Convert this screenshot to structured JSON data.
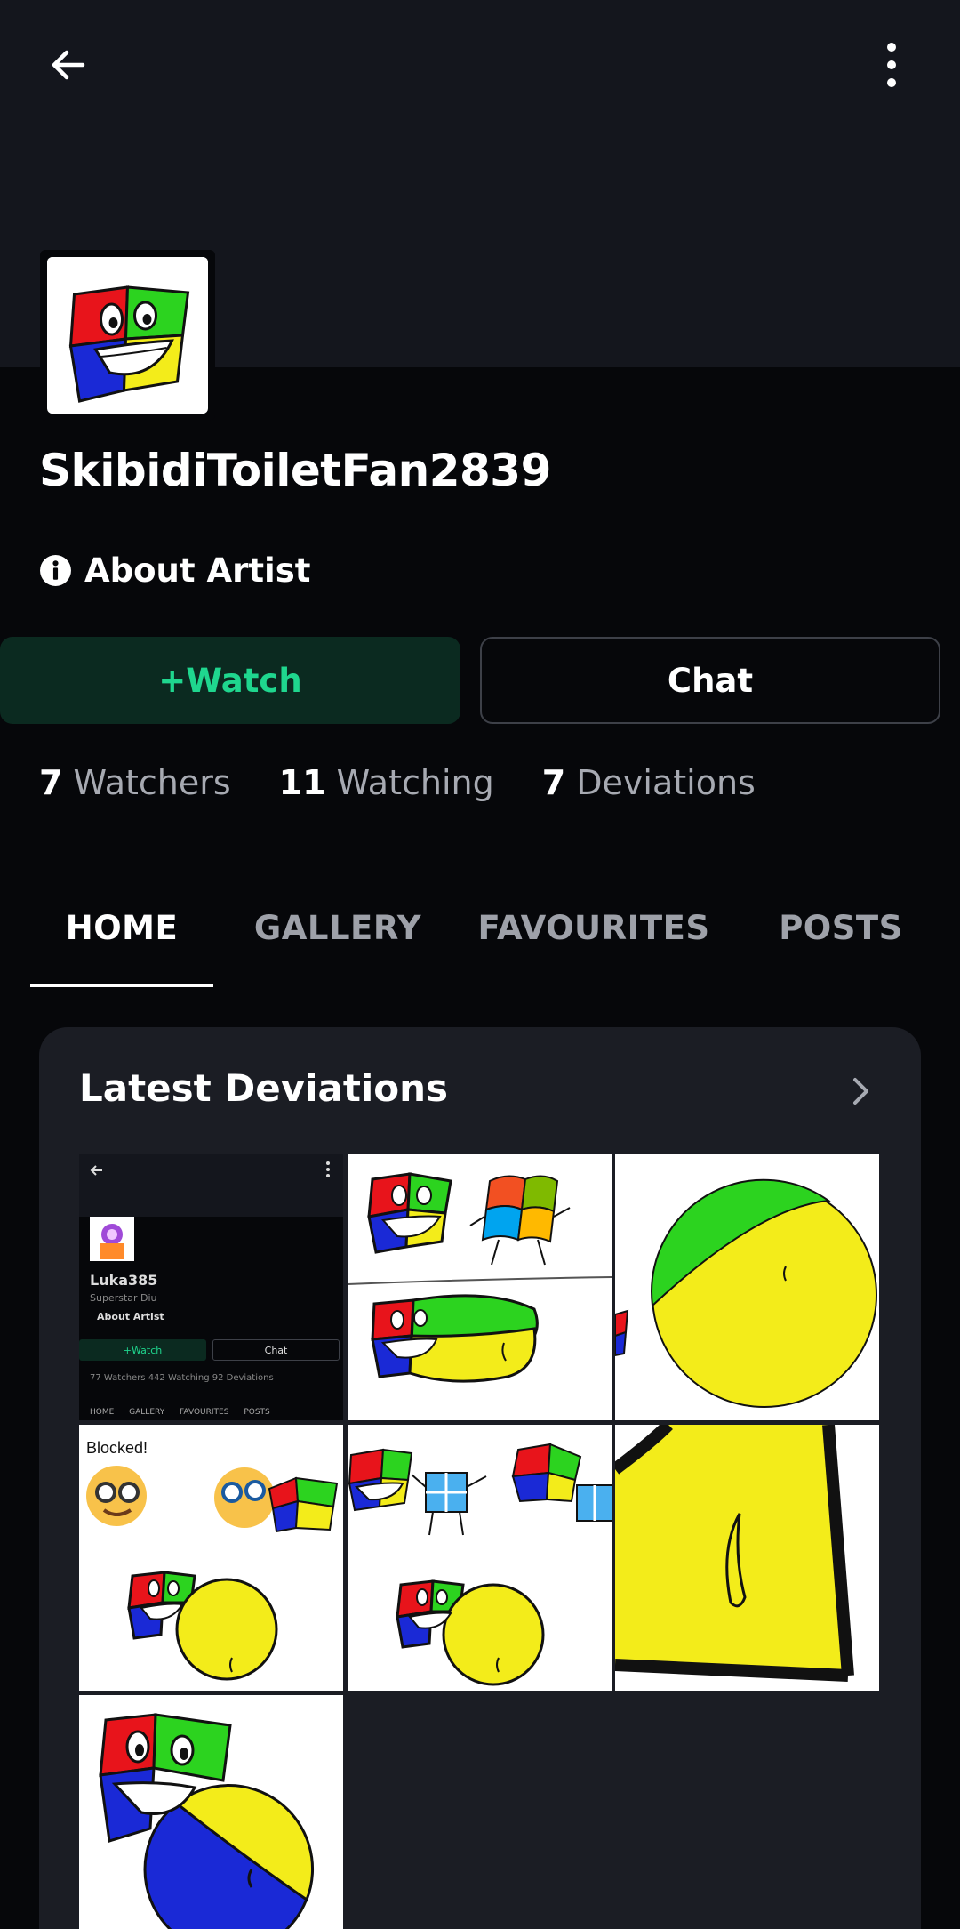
{
  "profile": {
    "username": "SkibidiToiletFan2839",
    "about_label": "About Artist"
  },
  "actions": {
    "watch_label": "+Watch",
    "chat_label": "Chat"
  },
  "stats": [
    {
      "count": "7",
      "label": "Watchers"
    },
    {
      "count": "11",
      "label": "Watching"
    },
    {
      "count": "7",
      "label": "Deviations"
    }
  ],
  "tabs": [
    {
      "label": "HOME",
      "active": true
    },
    {
      "label": "GALLERY",
      "active": false
    },
    {
      "label": "FAVOURITES",
      "active": false
    },
    {
      "label": "POSTS",
      "active": false
    }
  ],
  "latest": {
    "title": "Latest Deviations",
    "thumb1": {
      "name": "Luka385",
      "subtitle": "Superstar Diu",
      "about": "About Artist",
      "watch": "+Watch",
      "chat": "Chat",
      "stats": "77 Watchers   442 Watching   92 Deviations",
      "tabs": "HOME GALLERY FAVOURITES POSTS"
    },
    "thumb4_text": "Blocked!"
  },
  "colors": {
    "accent": "#1fd68e",
    "watch_bg": "#0b2a20",
    "background": "#06070a",
    "banner": "#14161d",
    "card": "#1b1d24",
    "muted": "#a7aab2"
  },
  "icons": {
    "back": "arrow-left-icon",
    "more": "more-vertical-icon",
    "info": "info-icon",
    "chevron": "chevron-right-icon"
  }
}
